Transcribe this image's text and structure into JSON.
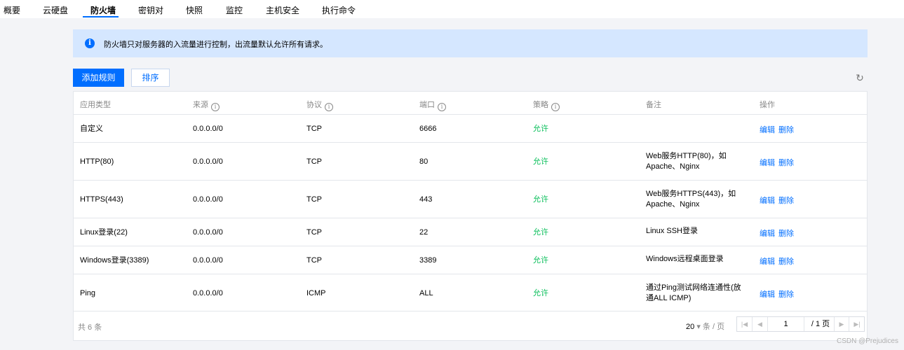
{
  "nav": {
    "tabs": [
      "概要",
      "云硬盘",
      "防火墙",
      "密钥对",
      "快照",
      "监控",
      "主机安全",
      "执行命令"
    ],
    "active_index": 2
  },
  "alert": {
    "icon": "info-icon",
    "text": "防火墙只对服务器的入流量进行控制，出流量默认允许所有请求。"
  },
  "toolbar": {
    "add_rule_label": "添加规则",
    "sort_label": "排序",
    "refresh_icon": "refresh-icon"
  },
  "table": {
    "headers": [
      "应用类型",
      "来源",
      "协议",
      "端口",
      "策略",
      "备注",
      "操作"
    ],
    "rows": [
      {
        "type": "自定义",
        "source": "0.0.0.0/0",
        "protocol": "TCP",
        "port": "6666",
        "policy": "允许",
        "note": "",
        "edit": "编辑",
        "delete": "删除"
      },
      {
        "type": "HTTP(80)",
        "source": "0.0.0.0/0",
        "protocol": "TCP",
        "port": "80",
        "policy": "允许",
        "note": "Web服务HTTP(80)，如Apache、Nginx",
        "edit": "编辑",
        "delete": "删除"
      },
      {
        "type": "HTTPS(443)",
        "source": "0.0.0.0/0",
        "protocol": "TCP",
        "port": "443",
        "policy": "允许",
        "note": "Web服务HTTPS(443)，如Apache、Nginx",
        "edit": "编辑",
        "delete": "删除"
      },
      {
        "type": "Linux登录(22)",
        "source": "0.0.0.0/0",
        "protocol": "TCP",
        "port": "22",
        "policy": "允许",
        "note": "Linux SSH登录",
        "edit": "编辑",
        "delete": "删除"
      },
      {
        "type": "Windows登录(3389)",
        "source": "0.0.0.0/0",
        "protocol": "TCP",
        "port": "3389",
        "policy": "允许",
        "note": "Windows远程桌面登录",
        "edit": "编辑",
        "delete": "删除"
      },
      {
        "type": "Ping",
        "source": "0.0.0.0/0",
        "protocol": "ICMP",
        "port": "ALL",
        "policy": "允许",
        "note": "通过Ping测试网络连通性(放通ALL ICMP)",
        "edit": "编辑",
        "delete": "删除"
      }
    ]
  },
  "footer": {
    "total": "共 6 条",
    "page_size": "20",
    "page_size_unit": "条 / 页",
    "current_page": "1",
    "total_pages": "/ 1 页"
  },
  "watermark": "CSDN @Prejudices",
  "colors": {
    "accent": "#006eff",
    "allow": "#0abf5b",
    "alert_bg": "#d5e7ff"
  }
}
